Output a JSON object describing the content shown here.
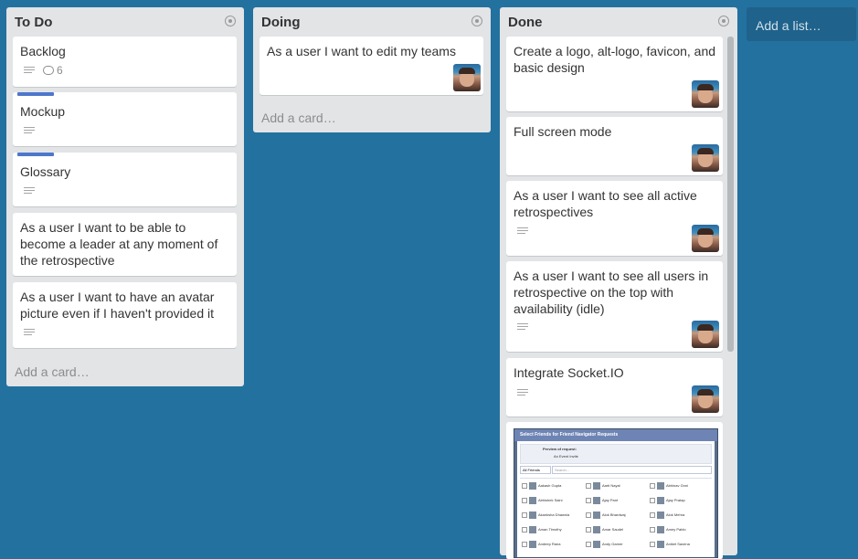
{
  "lists": [
    {
      "title": "To Do",
      "cards": [
        {
          "title": "Backlog",
          "comments": "6"
        },
        {
          "title": "Mockup"
        },
        {
          "title": "Glossary"
        },
        {
          "title": "As a user I want to be able to become a leader at any moment of the retrospective"
        },
        {
          "title": "As a user I want to have an avatar picture even if I haven't provided it"
        }
      ],
      "add_card": "Add a card…"
    },
    {
      "title": "Doing",
      "cards": [
        {
          "title": "As a user I want to edit my teams"
        }
      ],
      "add_card": "Add a card…"
    },
    {
      "title": "Done",
      "cards": [
        {
          "title": "Create a logo, alt-logo, favicon, and basic design"
        },
        {
          "title": "Full screen mode"
        },
        {
          "title": "As a user I want to see all active retrospectives"
        },
        {
          "title": "As a user I want to see all users in retrospective on the top with availability (idle)"
        },
        {
          "title": "Integrate Socket.IO"
        }
      ],
      "attachment": {
        "header": "Select Friends for Friend Navigator Requests",
        "preview_label": "Preview of request:",
        "preview_sub": "An Event Invite",
        "filter": "All Friends",
        "search_placeholder": "Search...",
        "friends": [
          "Aakash Gupta",
          "Aarti Nayal",
          "Abhinav Gnni",
          "Abhishek Saini",
          "Ajay Pant",
          "Ajay Pratap",
          "Akanksha Dhawnia",
          "Alok Bhardwaj",
          "Alok Mehra",
          "Aman Timothy",
          "Amar Saudel",
          "Amey Pablo",
          "Andeep Rana",
          "Andy Garner",
          "Aniket Saxena"
        ]
      }
    }
  ],
  "add_list": "Add a list…",
  "colors": {
    "board": "#23719f",
    "label": "#4d77cb"
  }
}
